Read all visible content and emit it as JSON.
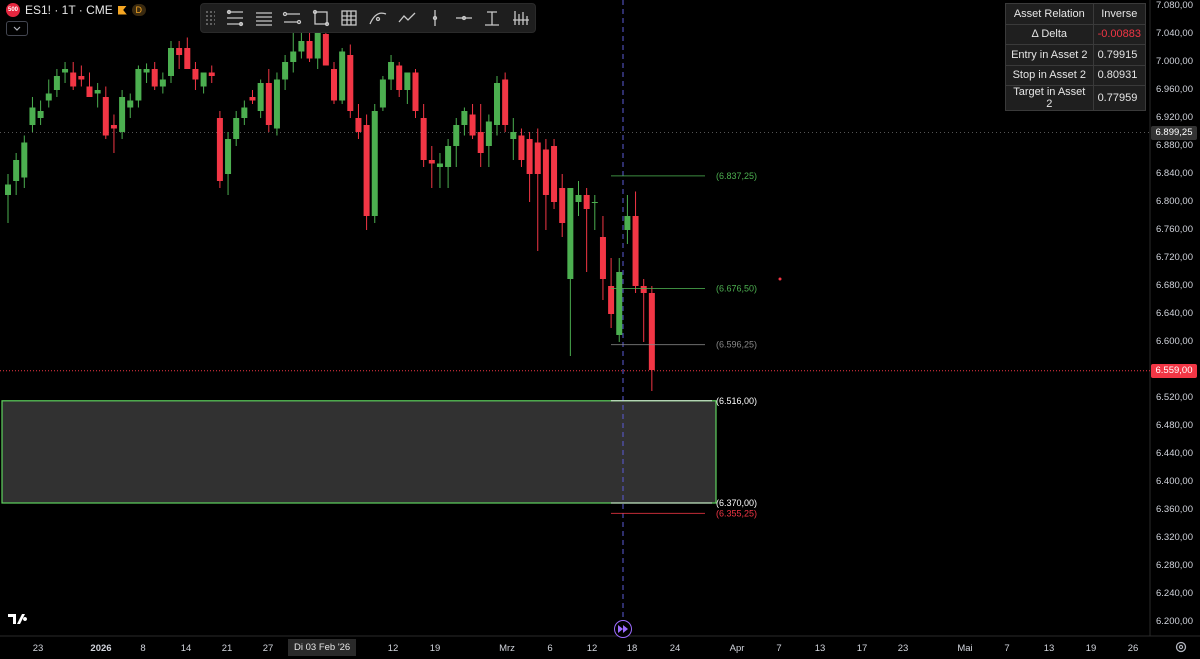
{
  "symbol": {
    "logo_text": "500",
    "title": "ES1! · 1T · CME",
    "badge": "D",
    "collapse_icon": "chevron-down-icon"
  },
  "toolbar": {
    "icons": [
      "grip-icon",
      "fib-retracement-icon",
      "horizontal-lines-icon",
      "trend-channel-icon",
      "rectangle-icon",
      "grid-icon",
      "curve-icon",
      "path-icon",
      "vertical-line-icon",
      "horizontal-ray-icon",
      "anchored-text-icon",
      "volume-profile-icon"
    ]
  },
  "table": {
    "header": [
      "Asset Relation",
      "Inverse"
    ],
    "rows": [
      {
        "label": "Δ Delta",
        "value": "-0.00883"
      },
      {
        "label": "Entry in Asset 2",
        "value": "0.79915"
      },
      {
        "label": "Stop in Asset 2",
        "value": "0.80931"
      },
      {
        "label": "Target in Asset 2",
        "value": "0.77959"
      }
    ]
  },
  "colors": {
    "up": "#4caf50",
    "down": "#f23645",
    "zone_border": "#5fd35f",
    "zone_fill": "#3a3a3a",
    "crosshair": "#5b5bd6",
    "last_price_tag": "#f23645",
    "current_level_tag": "#333333"
  },
  "chart_data": {
    "type": "candlestick",
    "ylim": [
      6200,
      7080
    ],
    "price_axis": [
      "7.080,00",
      "7.040,00",
      "7.000,00",
      "6.960,00",
      "6.920,00",
      "6.880,00",
      "6.840,00",
      "6.800,00",
      "6.760,00",
      "6.720,00",
      "6.680,00",
      "6.640,00",
      "6.600,00",
      "6.560,00",
      "6.520,00",
      "6.480,00",
      "6.440,00",
      "6.400,00",
      "6.360,00",
      "6.320,00",
      "6.280,00",
      "6.240,00",
      "6.200,00"
    ],
    "current_level": {
      "value": 6899.25,
      "label": "6.899,25"
    },
    "last_price": {
      "value": 6559.0,
      "label": "6.559,00"
    },
    "time_axis": [
      {
        "label": "23",
        "bold": false
      },
      {
        "label": "2026",
        "bold": true
      },
      {
        "label": "8",
        "bold": false
      },
      {
        "label": "14",
        "bold": false
      },
      {
        "label": "21",
        "bold": false
      },
      {
        "label": "27",
        "bold": false
      },
      {
        "label": "12",
        "bold": false
      },
      {
        "label": "19",
        "bold": false
      },
      {
        "label": "Mrz",
        "bold": false
      },
      {
        "label": "6",
        "bold": false
      },
      {
        "label": "12",
        "bold": false
      },
      {
        "label": "18",
        "bold": false
      },
      {
        "label": "24",
        "bold": false
      },
      {
        "label": "Apr",
        "bold": false
      },
      {
        "label": "7",
        "bold": false
      },
      {
        "label": "13",
        "bold": false
      },
      {
        "label": "17",
        "bold": false
      },
      {
        "label": "23",
        "bold": false
      },
      {
        "label": "Mai",
        "bold": false
      },
      {
        "label": "7",
        "bold": false
      },
      {
        "label": "13",
        "bold": false
      },
      {
        "label": "19",
        "bold": false
      },
      {
        "label": "26",
        "bold": false
      }
    ],
    "crosshair_date": "Di 03 Feb '26",
    "levels": [
      {
        "value": 6837.25,
        "label": "(6.837,25)",
        "color": "#4caf50"
      },
      {
        "value": 6676.5,
        "label": "(6.676,50)",
        "color": "#4caf50"
      },
      {
        "value": 6596.25,
        "label": "(6.596,25)",
        "color": "#888888"
      },
      {
        "value": 6516.0,
        "label": "(6.516,00)",
        "color": "#ffffff"
      },
      {
        "value": 6370.0,
        "label": "(6.370,00)",
        "color": "#ffffff"
      },
      {
        "value": 6355.25,
        "label": "(6.355,25)",
        "color": "#f23645"
      }
    ],
    "zone": {
      "top": 6516,
      "bottom": 6370
    },
    "candles": [
      {
        "o": 6810,
        "h": 6840,
        "l": 6770,
        "c": 6825
      },
      {
        "o": 6830,
        "h": 6870,
        "l": 6810,
        "c": 6860
      },
      {
        "o": 6835,
        "h": 6895,
        "l": 6820,
        "c": 6885
      },
      {
        "o": 6910,
        "h": 6950,
        "l": 6900,
        "c": 6935
      },
      {
        "o": 6920,
        "h": 6945,
        "l": 6910,
        "c": 6930
      },
      {
        "o": 6945,
        "h": 6975,
        "l": 6935,
        "c": 6955
      },
      {
        "o": 6960,
        "h": 6990,
        "l": 6950,
        "c": 6980
      },
      {
        "o": 6985,
        "h": 7000,
        "l": 6970,
        "c": 6990
      },
      {
        "o": 6985,
        "h": 7000,
        "l": 6960,
        "c": 6965
      },
      {
        "o": 6980,
        "h": 6995,
        "l": 6965,
        "c": 6975
      },
      {
        "o": 6965,
        "h": 6985,
        "l": 6950,
        "c": 6950
      },
      {
        "o": 6955,
        "h": 6970,
        "l": 6935,
        "c": 6960
      },
      {
        "o": 6950,
        "h": 6965,
        "l": 6890,
        "c": 6895
      },
      {
        "o": 6910,
        "h": 6925,
        "l": 6870,
        "c": 6905
      },
      {
        "o": 6900,
        "h": 6960,
        "l": 6890,
        "c": 6950
      },
      {
        "o": 6935,
        "h": 6955,
        "l": 6920,
        "c": 6945
      },
      {
        "o": 6945,
        "h": 6995,
        "l": 6935,
        "c": 6990
      },
      {
        "o": 6985,
        "h": 6998,
        "l": 6970,
        "c": 6990
      },
      {
        "o": 6990,
        "h": 7000,
        "l": 6960,
        "c": 6965
      },
      {
        "o": 6965,
        "h": 6985,
        "l": 6955,
        "c": 6975
      },
      {
        "o": 6980,
        "h": 7030,
        "l": 6970,
        "c": 7020
      },
      {
        "o": 7020,
        "h": 7030,
        "l": 6990,
        "c": 7010
      },
      {
        "o": 7020,
        "h": 7035,
        "l": 6990,
        "c": 6990
      },
      {
        "o": 6990,
        "h": 7000,
        "l": 6960,
        "c": 6975
      },
      {
        "o": 6965,
        "h": 6985,
        "l": 6955,
        "c": 6985
      },
      {
        "o": 6985,
        "h": 6995,
        "l": 6970,
        "c": 6980
      },
      {
        "o": 6920,
        "h": 6930,
        "l": 6820,
        "c": 6830
      },
      {
        "o": 6840,
        "h": 6900,
        "l": 6810,
        "c": 6890
      },
      {
        "o": 6890,
        "h": 6930,
        "l": 6880,
        "c": 6920
      },
      {
        "o": 6920,
        "h": 6945,
        "l": 6910,
        "c": 6935
      },
      {
        "o": 6950,
        "h": 6960,
        "l": 6940,
        "c": 6945
      },
      {
        "o": 6930,
        "h": 6975,
        "l": 6920,
        "c": 6970
      },
      {
        "o": 6970,
        "h": 6990,
        "l": 6900,
        "c": 6910
      },
      {
        "o": 6905,
        "h": 6985,
        "l": 6895,
        "c": 6975
      },
      {
        "o": 6975,
        "h": 7010,
        "l": 6960,
        "c": 7000
      },
      {
        "o": 7000,
        "h": 7045,
        "l": 6985,
        "c": 7015
      },
      {
        "o": 7015,
        "h": 7055,
        "l": 7005,
        "c": 7030
      },
      {
        "o": 7030,
        "h": 7080,
        "l": 7000,
        "c": 7005
      },
      {
        "o": 7005,
        "h": 7060,
        "l": 6990,
        "c": 7045
      },
      {
        "o": 7040,
        "h": 7050,
        "l": 7000,
        "c": 6995
      },
      {
        "o": 6990,
        "h": 7000,
        "l": 6940,
        "c": 6945
      },
      {
        "o": 6945,
        "h": 7020,
        "l": 6940,
        "c": 7015
      },
      {
        "o": 7010,
        "h": 7025,
        "l": 6920,
        "c": 6930
      },
      {
        "o": 6920,
        "h": 6940,
        "l": 6890,
        "c": 6900
      },
      {
        "o": 6910,
        "h": 6925,
        "l": 6760,
        "c": 6780
      },
      {
        "o": 6780,
        "h": 6940,
        "l": 6770,
        "c": 6930
      },
      {
        "o": 6935,
        "h": 6980,
        "l": 6930,
        "c": 6975
      },
      {
        "o": 6975,
        "h": 7010,
        "l": 6960,
        "c": 7000
      },
      {
        "o": 6995,
        "h": 7000,
        "l": 6950,
        "c": 6960
      },
      {
        "o": 6960,
        "h": 6985,
        "l": 6940,
        "c": 6985
      },
      {
        "o": 6985,
        "h": 6990,
        "l": 6920,
        "c": 6930
      },
      {
        "o": 6920,
        "h": 6940,
        "l": 6850,
        "c": 6860
      },
      {
        "o": 6860,
        "h": 6880,
        "l": 6820,
        "c": 6855
      },
      {
        "o": 6850,
        "h": 6870,
        "l": 6820,
        "c": 6855
      },
      {
        "o": 6850,
        "h": 6890,
        "l": 6820,
        "c": 6880
      },
      {
        "o": 6880,
        "h": 6920,
        "l": 6850,
        "c": 6910
      },
      {
        "o": 6910,
        "h": 6935,
        "l": 6895,
        "c": 6930
      },
      {
        "o": 6925,
        "h": 6940,
        "l": 6890,
        "c": 6895
      },
      {
        "o": 6900,
        "h": 6940,
        "l": 6850,
        "c": 6870
      },
      {
        "o": 6880,
        "h": 6925,
        "l": 6850,
        "c": 6915
      },
      {
        "o": 6910,
        "h": 6980,
        "l": 6895,
        "c": 6970
      },
      {
        "o": 6975,
        "h": 6985,
        "l": 6900,
        "c": 6910
      },
      {
        "o": 6890,
        "h": 6920,
        "l": 6860,
        "c": 6900
      },
      {
        "o": 6895,
        "h": 6905,
        "l": 6850,
        "c": 6860
      },
      {
        "o": 6890,
        "h": 6900,
        "l": 6800,
        "c": 6840
      },
      {
        "o": 6885,
        "h": 6905,
        "l": 6730,
        "c": 6840
      },
      {
        "o": 6875,
        "h": 6890,
        "l": 6760,
        "c": 6810
      },
      {
        "o": 6880,
        "h": 6890,
        "l": 6790,
        "c": 6800
      },
      {
        "o": 6820,
        "h": 6840,
        "l": 6750,
        "c": 6770
      },
      {
        "o": 6690,
        "h": 6770,
        "l": 6580,
        "c": 6820
      },
      {
        "o": 6800,
        "h": 6830,
        "l": 6780,
        "c": 6810
      },
      {
        "o": 6810,
        "h": 6820,
        "l": 6700,
        "c": 6790
      },
      {
        "o": 6800,
        "h": 6810,
        "l": 6760,
        "c": 6800
      },
      {
        "o": 6750,
        "h": 6780,
        "l": 6660,
        "c": 6690
      },
      {
        "o": 6680,
        "h": 6720,
        "l": 6620,
        "c": 6640
      },
      {
        "o": 6610,
        "h": 6720,
        "l": 6600,
        "c": 6700
      },
      {
        "o": 6760,
        "h": 6810,
        "l": 6740,
        "c": 6780
      },
      {
        "o": 6780,
        "h": 6815,
        "l": 6670,
        "c": 6680
      },
      {
        "o": 6680,
        "h": 6690,
        "l": 6600,
        "c": 6670
      },
      {
        "o": 6670,
        "h": 6680,
        "l": 6530,
        "c": 6560
      }
    ]
  }
}
